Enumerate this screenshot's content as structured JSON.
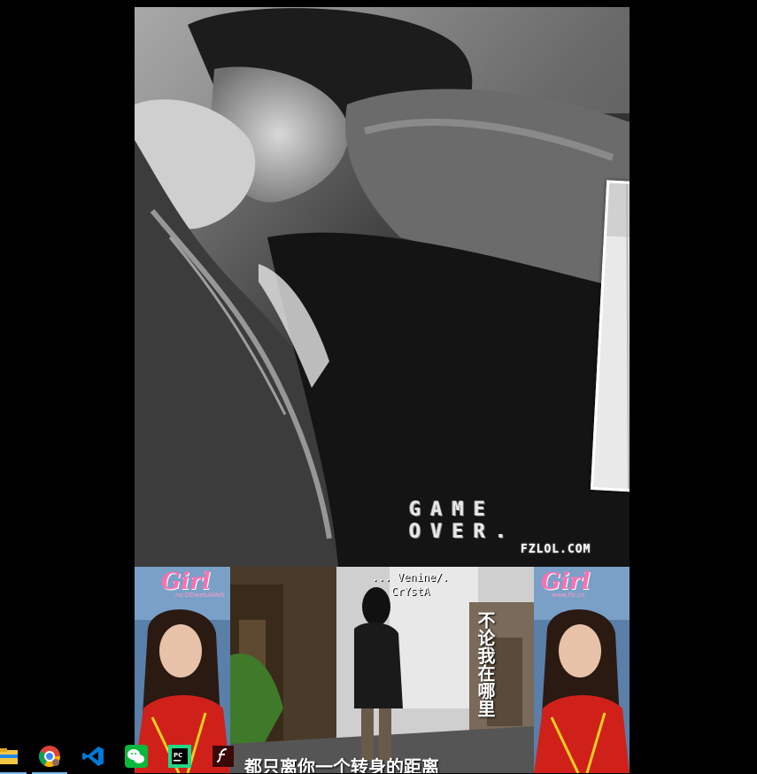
{
  "wallpaper": {
    "main_overlay_text": "GAME OVER.",
    "site_watermark": "FZLOL.COM",
    "bottom_strip": {
      "left_logo": "Girl",
      "left_sub": "no.DDwebAWeb",
      "right_logo": "Girl",
      "right_sub": "www.flz.cn",
      "signature_line1": "... Venine/.",
      "signature_line2": "CrYstA",
      "vertical_caption": "不论我在哪里",
      "bottom_caption": "都只离你一个转身的距离"
    }
  },
  "taskbar": {
    "icons": [
      {
        "name": "file-explorer",
        "active": true
      },
      {
        "name": "chrome",
        "active": true
      },
      {
        "name": "vscode",
        "active": false
      },
      {
        "name": "wechat",
        "active": false
      },
      {
        "name": "pycharm",
        "active": false
      },
      {
        "name": "flash",
        "active": false
      }
    ],
    "colors": {
      "active_indicator": "#76b9ed",
      "chrome_red": "#db4437",
      "vscode_blue": "#0078d4",
      "wechat_green": "#09b83e",
      "pycharm_green": "#21d789",
      "flash_red": "#b30b00"
    }
  }
}
